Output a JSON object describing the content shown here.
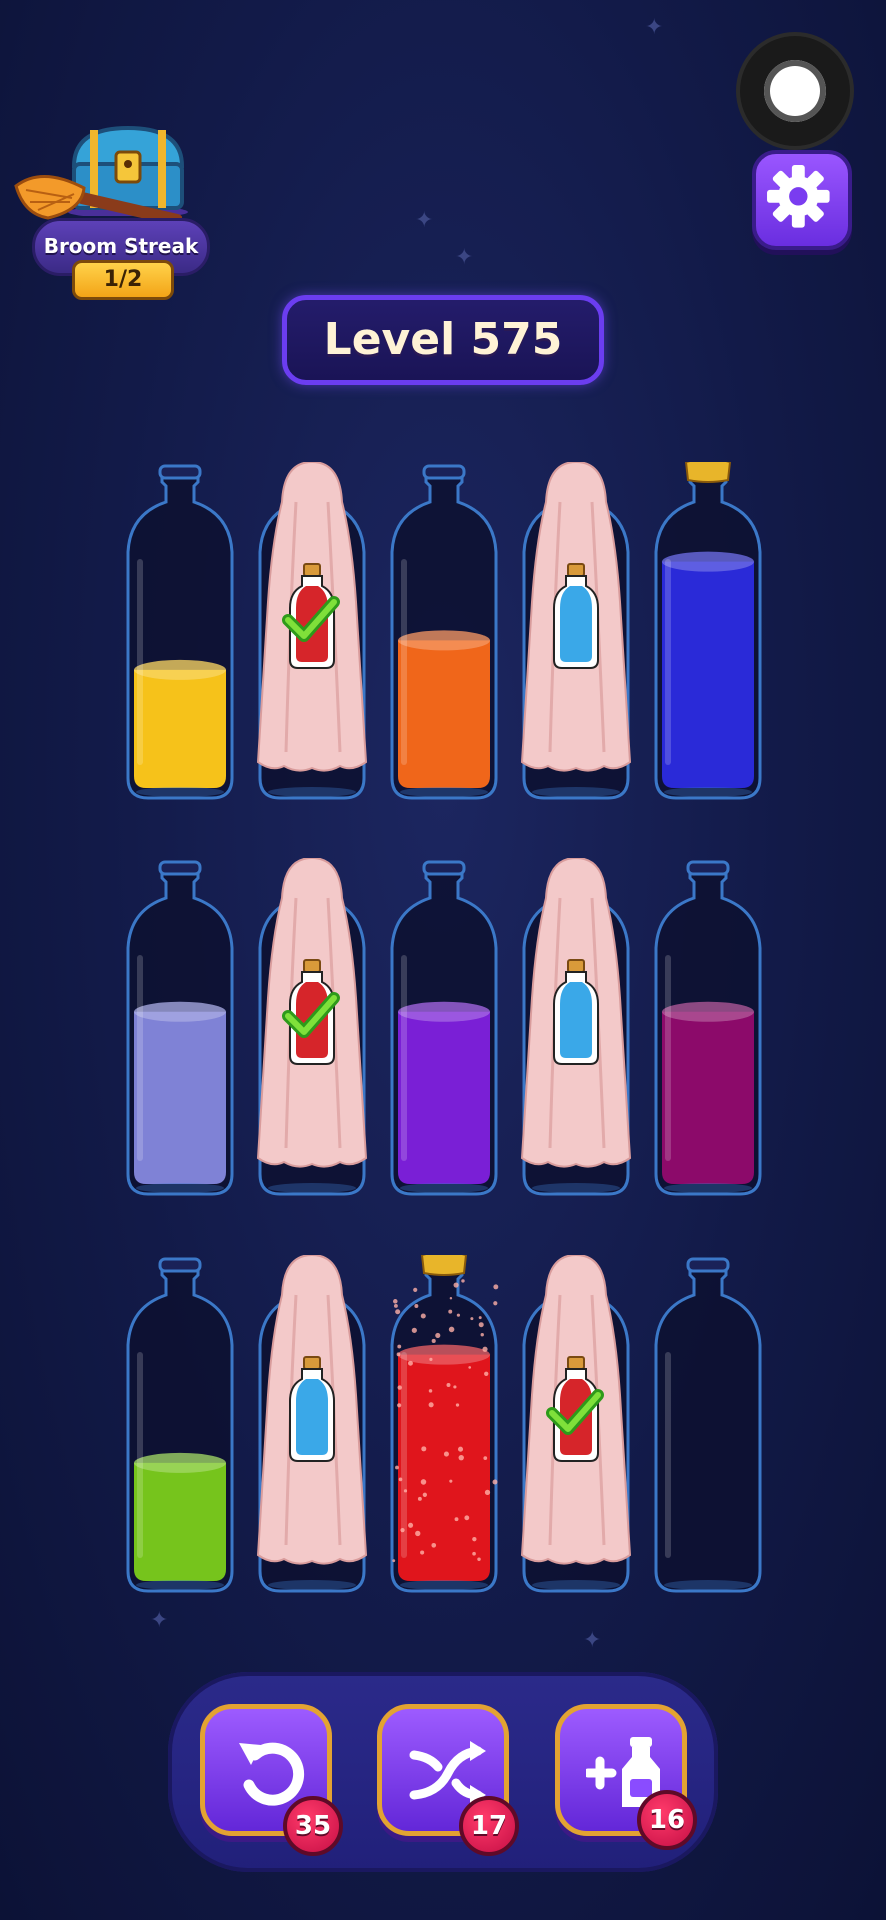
{
  "streak": {
    "label": "Broom Streak",
    "progress_text": "1/2"
  },
  "level": {
    "title": "Level 575"
  },
  "colors": {
    "yellow": "#f6c21a",
    "orange": "#f0661a",
    "blue": "#2a2ad8",
    "lavender": "#7f82d6",
    "purple": "#7a1fd6",
    "magenta": "#8c0a6a",
    "red": "#e0151c",
    "green": "#76c41c",
    "hint_blue": "#3aa8e8",
    "hint_red": "#d6252a"
  },
  "grid": {
    "rows": [
      [
        {
          "state": "open",
          "fill_level": 0.48,
          "color": "yellow"
        },
        {
          "state": "covered",
          "hint": "red",
          "completed": true
        },
        {
          "state": "open",
          "fill_level": 0.6,
          "color": "orange"
        },
        {
          "state": "covered",
          "hint": "blue",
          "completed": false
        },
        {
          "state": "corked",
          "fill_level": 0.92,
          "color": "blue"
        }
      ],
      [
        {
          "state": "open",
          "fill_level": 0.7,
          "color": "lavender"
        },
        {
          "state": "covered",
          "hint": "red",
          "completed": true
        },
        {
          "state": "open",
          "fill_level": 0.7,
          "color": "purple"
        },
        {
          "state": "covered",
          "hint": "blue",
          "completed": false
        },
        {
          "state": "open",
          "fill_level": 0.7,
          "color": "magenta"
        }
      ],
      [
        {
          "state": "open",
          "fill_level": 0.48,
          "color": "green"
        },
        {
          "state": "covered",
          "hint": "blue",
          "completed": false
        },
        {
          "state": "corked",
          "fill_level": 0.92,
          "color": "red",
          "sparkle": true
        },
        {
          "state": "covered",
          "hint": "red",
          "completed": true
        },
        {
          "state": "open",
          "fill_level": 0.0,
          "color": "none"
        }
      ]
    ]
  },
  "toolbar": {
    "undo": {
      "icon": "undo-icon",
      "count": "35"
    },
    "shuffle": {
      "icon": "shuffle-icon",
      "count": "17"
    },
    "add_bottle": {
      "icon": "add-bottle-icon",
      "count": "16"
    }
  }
}
